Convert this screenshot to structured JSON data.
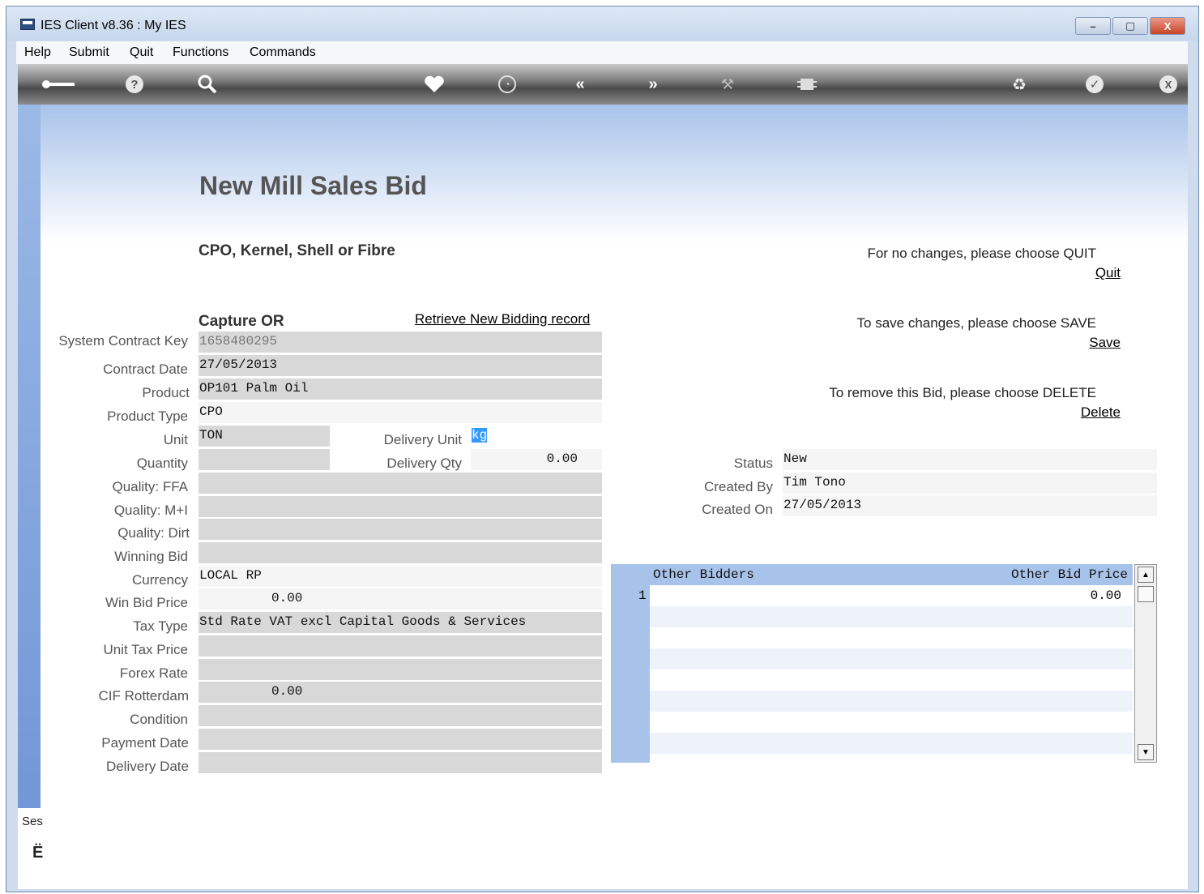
{
  "window": {
    "title": "IES Client v8.36 : My IES",
    "buttons": [
      "–",
      "▢",
      "X"
    ]
  },
  "menu": [
    "Help",
    "Submit",
    "Quit",
    "Functions",
    "Commands"
  ],
  "toolbar_icons": [
    "key-icon",
    "help-icon",
    "search-icon",
    "heart-icon",
    "clock-icon",
    "back-icon",
    "forward-icon",
    "tools-icon",
    "chip-icon",
    "recycle-icon",
    "check-icon",
    "close-icon"
  ],
  "page": {
    "title": "New Mill Sales Bid",
    "subtitle": "CPO, Kernel, Shell or Fibre",
    "capture": "Capture OR",
    "retrieve_link": "Retrieve New Bidding record"
  },
  "actions": {
    "quit_note": "For no changes, please choose QUIT",
    "quit_link": "Quit",
    "save_note": "To save changes, please choose SAVE",
    "save_link": "Save",
    "delete_note": "To remove this Bid,  please choose  DELETE",
    "delete_link": "Delete"
  },
  "form": {
    "system_contract_key": {
      "label": "System Contract Key",
      "value": "1658480295"
    },
    "contract_date": {
      "label": "Contract Date",
      "value": "27/05/2013"
    },
    "product": {
      "label": "Product",
      "value": "OP101 Palm Oil"
    },
    "product_type": {
      "label": "Product Type",
      "value": "CPO"
    },
    "unit": {
      "label": "Unit",
      "value": "TON"
    },
    "delivery_unit": {
      "label": "Delivery Unit",
      "value": "kg"
    },
    "quantity": {
      "label": "Quantity",
      "value": ""
    },
    "delivery_qty": {
      "label": "Delivery Qty",
      "value": "0.00"
    },
    "quality_ffa": {
      "label": "Quality: FFA",
      "value": ""
    },
    "quality_mi": {
      "label": "Quality: M+I",
      "value": ""
    },
    "quality_dirt": {
      "label": "Quality: Dirt",
      "value": ""
    },
    "winning_bid": {
      "label": "Winning Bid",
      "value": ""
    },
    "currency": {
      "label": "Currency",
      "value": "LOCAL RP"
    },
    "win_bid_price": {
      "label": "Win Bid Price",
      "value": "0.00"
    },
    "tax_type": {
      "label": "Tax Type",
      "value": "Std Rate VAT excl Capital Goods & Services"
    },
    "unit_tax_price": {
      "label": "Unit Tax Price",
      "value": ""
    },
    "forex_rate": {
      "label": "Forex Rate",
      "value": ""
    },
    "cif_rotterdam": {
      "label": "CIF Rotterdam",
      "value": "0.00"
    },
    "condition": {
      "label": "Condition",
      "value": ""
    },
    "payment_date": {
      "label": "Payment Date",
      "value": ""
    },
    "delivery_date": {
      "label": "Delivery Date",
      "value": ""
    }
  },
  "status": {
    "status": {
      "label": "Status",
      "value": "New"
    },
    "created_by": {
      "label": "Created By",
      "value": "Tim Tono"
    },
    "created_on": {
      "label": "Created On",
      "value": "27/05/2013"
    }
  },
  "grid": {
    "col1": "Other Bidders",
    "col2": "Other Bid Price",
    "rows": [
      {
        "num": "1",
        "bidder": "",
        "price": "0.00"
      }
    ]
  },
  "sidebar": {
    "session_label": "Ses"
  }
}
